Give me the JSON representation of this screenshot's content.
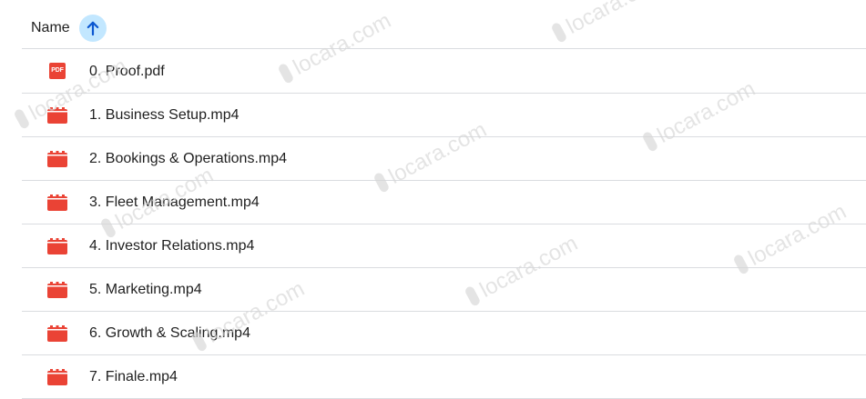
{
  "header": {
    "column_label": "Name",
    "sort_direction": "ascending"
  },
  "files": [
    {
      "name": "0. Proof.pdf",
      "type": "pdf",
      "icon": "pdf-icon",
      "icon_text": "PDF"
    },
    {
      "name": "1. Business Setup.mp4",
      "type": "video",
      "icon": "video-icon"
    },
    {
      "name": "2. Bookings & Operations.mp4",
      "type": "video",
      "icon": "video-icon"
    },
    {
      "name": "3. Fleet Management.mp4",
      "type": "video",
      "icon": "video-icon"
    },
    {
      "name": "4. Investor Relations.mp4",
      "type": "video",
      "icon": "video-icon"
    },
    {
      "name": "5. Marketing.mp4",
      "type": "video",
      "icon": "video-icon"
    },
    {
      "name": "6. Growth & Scaling.mp4",
      "type": "video",
      "icon": "video-icon"
    },
    {
      "name": "7. Finale.mp4",
      "type": "video",
      "icon": "video-icon"
    }
  ],
  "watermark": {
    "text": "locara.com"
  },
  "colors": {
    "accent_bg": "#c2e7ff",
    "accent_icon": "#0b57d0",
    "file_icon_red": "#ea4335",
    "divider": "#dadce0",
    "text": "#1f1f1f"
  }
}
